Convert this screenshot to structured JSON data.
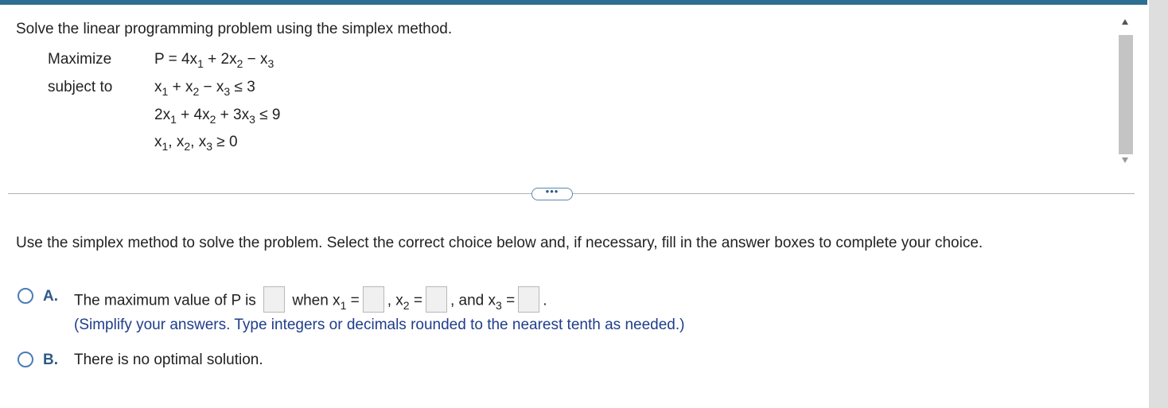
{
  "question": {
    "intro": "Solve the linear programming problem using the simplex method.",
    "maximize_label": "Maximize",
    "subject_to_label": "subject to",
    "objective": {
      "lhs": "P = 4x",
      "sub1": "1",
      "t2": " + 2x",
      "sub2": "2",
      "t3": " − x",
      "sub3": "3"
    },
    "constraint1": {
      "t1": "x",
      "sub1": "1",
      "t2": " + x",
      "sub2": "2",
      "t3": " − x",
      "sub3": "3",
      "rhs": " ≤ 3"
    },
    "constraint2": {
      "t1": "2x",
      "sub1": "1",
      "t2": " + 4x",
      "sub2": "2",
      "t3": " + 3x",
      "sub3": "3",
      "rhs": " ≤ 9"
    },
    "constraint3": {
      "t1": "x",
      "sub1": "1",
      "t2": ", x",
      "sub2": "2",
      "t3": ", x",
      "sub3": "3",
      "rhs": " ≥ 0"
    }
  },
  "expand_label": "•••",
  "answer": {
    "instructions": "Use the simplex method to solve the problem. Select the correct choice below and, if necessary, fill in the answer boxes to complete your choice.",
    "choice_a": {
      "letter": "A.",
      "part1": "The maximum value of P is",
      "part2": "when x",
      "sub1": "1",
      "eq1": " =",
      "part3": ", x",
      "sub2": "2",
      "eq2": " =",
      "part4": ", and x",
      "sub3": "3",
      "eq3": " =",
      "end": ".",
      "hint": "(Simplify your answers. Type integers or decimals rounded to the nearest tenth as needed.)",
      "p_value": "",
      "x1_value": "",
      "x2_value": "",
      "x3_value": ""
    },
    "choice_b": {
      "letter": "B.",
      "text": "There is no optimal solution."
    }
  },
  "colors": {
    "top_bar": "#2d6e93",
    "accent": "#2d5a88",
    "hint": "#1f3d8a"
  }
}
